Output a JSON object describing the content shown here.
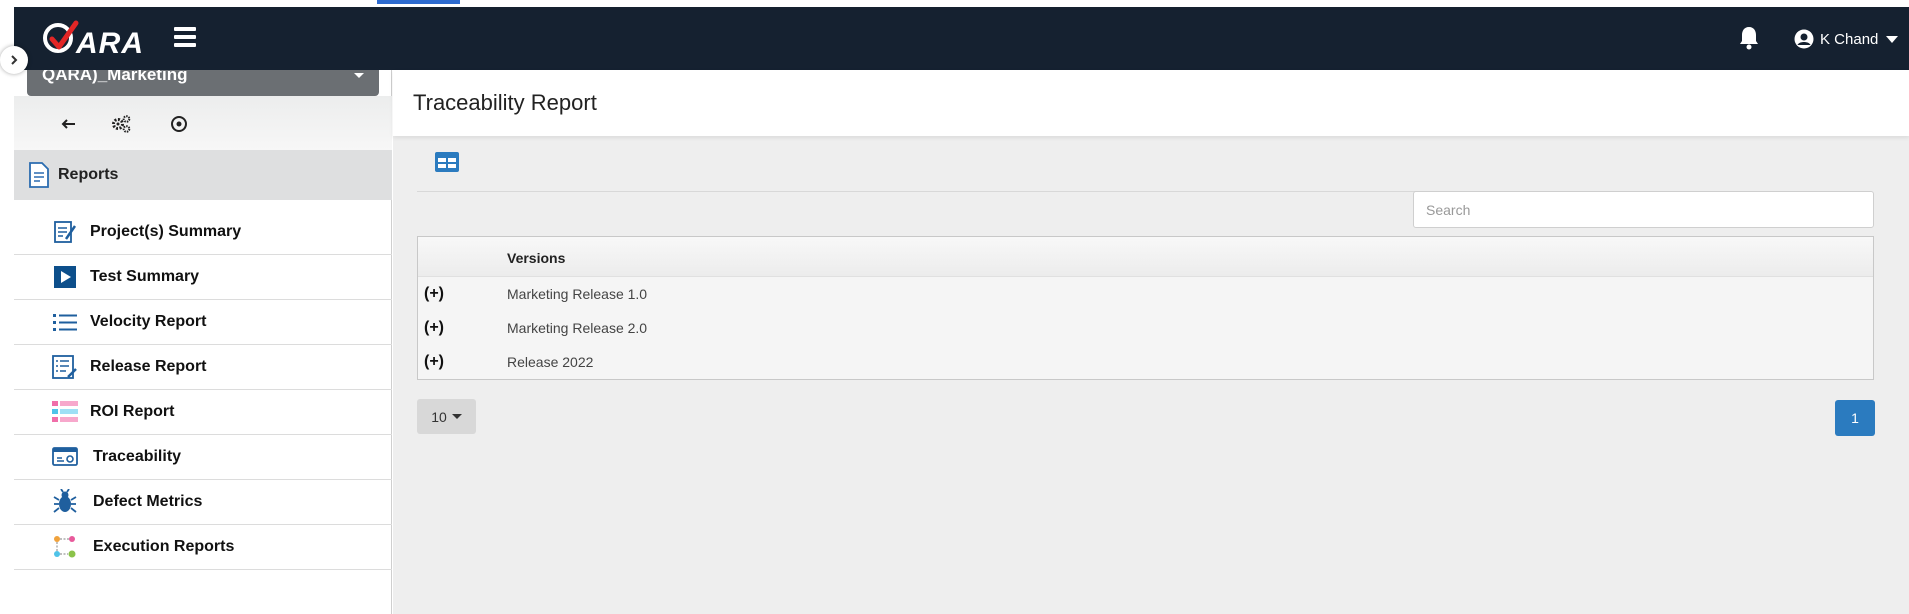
{
  "navbar": {
    "logo_text": "ARA",
    "user_name": "K Chand"
  },
  "sidebar": {
    "project": "QARA)_Marketing",
    "section_title": "Reports",
    "items": [
      {
        "label": "Project(s) Summary",
        "icon": "project-summary-icon"
      },
      {
        "label": "Test Summary",
        "icon": "play-icon"
      },
      {
        "label": "Velocity Report",
        "icon": "list-icon"
      },
      {
        "label": "Release Report",
        "icon": "release-report-icon"
      },
      {
        "label": "ROI Report",
        "icon": "roi-grid-icon"
      },
      {
        "label": "Traceability",
        "icon": "traceability-icon"
      },
      {
        "label": "Defect Metrics",
        "icon": "bug-icon"
      },
      {
        "label": "Execution Reports",
        "icon": "execution-icon"
      }
    ]
  },
  "page": {
    "title": "Traceability Report"
  },
  "search": {
    "placeholder": "Search"
  },
  "table": {
    "column_header": "Versions",
    "expand_symbol": "(+)",
    "rows": [
      "Marketing Release 1.0",
      "Marketing Release 2.0",
      "Release 2022"
    ]
  },
  "pagination": {
    "page_size": "10",
    "current_page": "1"
  },
  "colors": {
    "navbar": "#152130",
    "accent": "#2b7bbf",
    "logo_check": "#e32626"
  }
}
